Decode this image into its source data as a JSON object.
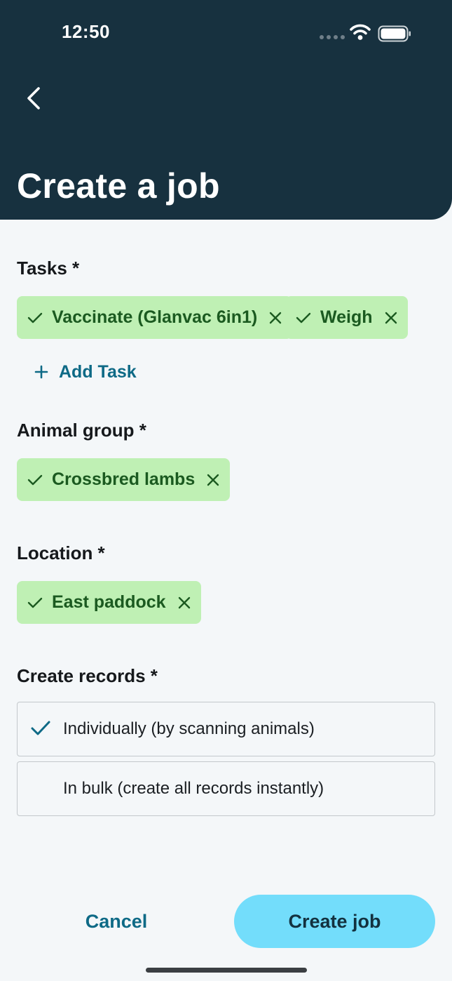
{
  "status_bar": {
    "time": "12:50"
  },
  "header": {
    "title": "Create a job"
  },
  "tasks": {
    "label": "Tasks *",
    "chips": [
      {
        "label": "Vaccinate (Glanvac 6in1)"
      },
      {
        "label": "Weigh"
      }
    ],
    "add_label": "Add Task"
  },
  "animal_group": {
    "label": "Animal group *",
    "chips": [
      {
        "label": "Crossbred lambs"
      }
    ]
  },
  "location": {
    "label": "Location *",
    "chips": [
      {
        "label": "East paddock"
      }
    ]
  },
  "create_records": {
    "label": "Create records *",
    "options": [
      {
        "label": "Individually (by scanning animals)",
        "selected": true
      },
      {
        "label": "In bulk (create all records instantly)",
        "selected": false
      }
    ]
  },
  "footer": {
    "cancel_label": "Cancel",
    "create_label": "Create job"
  },
  "colors": {
    "header_bg": "#17313f",
    "chip_bg": "#bff0b4",
    "chip_text": "#1b5a20",
    "accent": "#0e6a86",
    "primary_button": "#73ddfb"
  }
}
